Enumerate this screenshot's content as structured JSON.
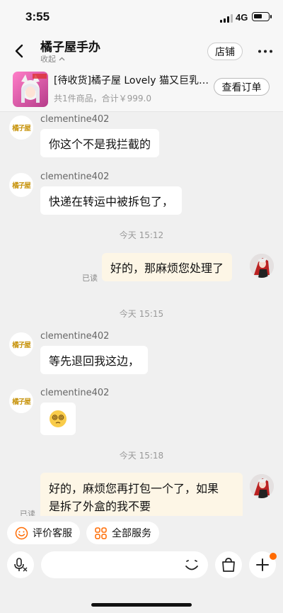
{
  "status": {
    "time": "3:55",
    "network": "4G"
  },
  "header": {
    "title": "橘子屋手办",
    "collapse_label": "收起",
    "store_button": "店铺"
  },
  "order": {
    "title": "[待收货]橘子屋 Lovely 猫又巨乳…",
    "summary": "共1件商品，合计￥999.0",
    "view_button": "查看订单"
  },
  "avatar_logo_text": "橘子屋",
  "messages": [
    {
      "type": "in",
      "sender": "clementine402",
      "text": "你这个不是我拦截的"
    },
    {
      "type": "in",
      "sender": "clementine402",
      "text": "快递在转运中被拆包了，"
    },
    {
      "type": "time",
      "text": "今天 15:12"
    },
    {
      "type": "out",
      "text": "好的，那麻烦您处理了",
      "status": "已读"
    },
    {
      "type": "time",
      "text": "今天 15:15"
    },
    {
      "type": "in",
      "sender": "clementine402",
      "text": "等先退回我这边，"
    },
    {
      "type": "in",
      "sender": "clementine402",
      "emoji": "dizzy-face"
    },
    {
      "type": "time",
      "text": "今天 15:18"
    },
    {
      "type": "out",
      "lines": [
        "好的，麻烦您再打包一个了，如果",
        "是拆了外盒的我不要"
      ],
      "status": "已读"
    }
  ],
  "quick_actions": {
    "rate": "评价客服",
    "services": "全部服务"
  },
  "input": {
    "placeholder": ""
  },
  "colors": {
    "accent_orange": "#ff6a00",
    "out_bubble": "#fdf6e6",
    "logo_gold": "#c89510"
  },
  "icons": [
    "back-arrow-icon",
    "chevron-up-icon",
    "more-dots-icon",
    "smiley-icon",
    "apps-grid-icon",
    "voice-icon",
    "emoji-icon",
    "shopping-bag-icon",
    "plus-icon"
  ]
}
